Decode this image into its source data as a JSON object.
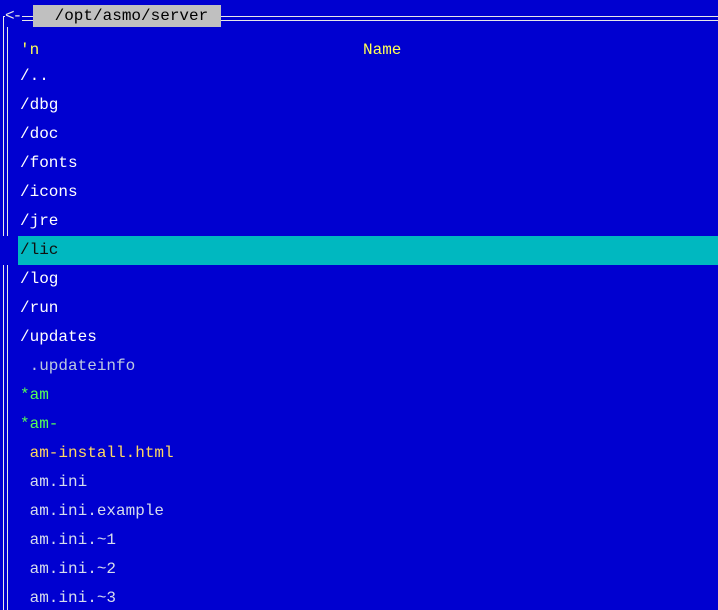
{
  "panel": {
    "nav_arrow": "<-",
    "path": " /opt/asmo/server",
    "sort_indicator": "'n",
    "column_name": "Name"
  },
  "colors": {
    "panel_bg": "#0000d0",
    "selection_bg": "#00b8c0",
    "directory": "#ffffff",
    "executable": "#55ff55",
    "header": "#ffff55",
    "html_file": "#ffd860"
  },
  "entries": [
    {
      "name": "/..",
      "kind": "dir"
    },
    {
      "name": "/dbg",
      "kind": "dir"
    },
    {
      "name": "/doc",
      "kind": "dir"
    },
    {
      "name": "/fonts",
      "kind": "dir"
    },
    {
      "name": "/icons",
      "kind": "dir"
    },
    {
      "name": "/jre",
      "kind": "dir"
    },
    {
      "name": "/lic",
      "kind": "dir",
      "selected": true
    },
    {
      "name": "/log",
      "kind": "dir"
    },
    {
      "name": "/run",
      "kind": "dir"
    },
    {
      "name": "/updates",
      "kind": "dir"
    },
    {
      "name": " .updateinfo",
      "kind": "hidden"
    },
    {
      "name": "*am",
      "kind": "exec"
    },
    {
      "name": "*am-",
      "kind": "exec"
    },
    {
      "name": " am-install.html",
      "kind": "html"
    },
    {
      "name": " am.ini",
      "kind": "file"
    },
    {
      "name": " am.ini.example",
      "kind": "file"
    },
    {
      "name": " am.ini.~1",
      "kind": "file"
    },
    {
      "name": " am.ini.~2",
      "kind": "file"
    },
    {
      "name": " am.ini.~3",
      "kind": "file"
    }
  ]
}
